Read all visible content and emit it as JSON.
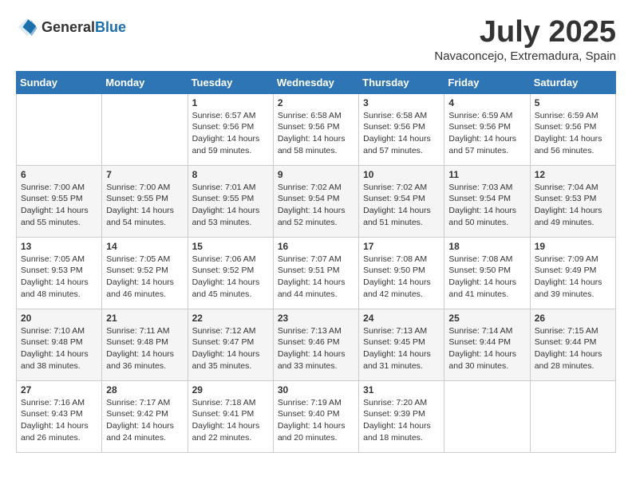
{
  "header": {
    "logo_general": "General",
    "logo_blue": "Blue",
    "month": "July 2025",
    "location": "Navaconcejo, Extremadura, Spain"
  },
  "weekdays": [
    "Sunday",
    "Monday",
    "Tuesday",
    "Wednesday",
    "Thursday",
    "Friday",
    "Saturday"
  ],
  "weeks": [
    [
      {
        "day": "",
        "sunrise": "",
        "sunset": "",
        "daylight": ""
      },
      {
        "day": "",
        "sunrise": "",
        "sunset": "",
        "daylight": ""
      },
      {
        "day": "1",
        "sunrise": "Sunrise: 6:57 AM",
        "sunset": "Sunset: 9:56 PM",
        "daylight": "Daylight: 14 hours and 59 minutes."
      },
      {
        "day": "2",
        "sunrise": "Sunrise: 6:58 AM",
        "sunset": "Sunset: 9:56 PM",
        "daylight": "Daylight: 14 hours and 58 minutes."
      },
      {
        "day": "3",
        "sunrise": "Sunrise: 6:58 AM",
        "sunset": "Sunset: 9:56 PM",
        "daylight": "Daylight: 14 hours and 57 minutes."
      },
      {
        "day": "4",
        "sunrise": "Sunrise: 6:59 AM",
        "sunset": "Sunset: 9:56 PM",
        "daylight": "Daylight: 14 hours and 57 minutes."
      },
      {
        "day": "5",
        "sunrise": "Sunrise: 6:59 AM",
        "sunset": "Sunset: 9:56 PM",
        "daylight": "Daylight: 14 hours and 56 minutes."
      }
    ],
    [
      {
        "day": "6",
        "sunrise": "Sunrise: 7:00 AM",
        "sunset": "Sunset: 9:55 PM",
        "daylight": "Daylight: 14 hours and 55 minutes."
      },
      {
        "day": "7",
        "sunrise": "Sunrise: 7:00 AM",
        "sunset": "Sunset: 9:55 PM",
        "daylight": "Daylight: 14 hours and 54 minutes."
      },
      {
        "day": "8",
        "sunrise": "Sunrise: 7:01 AM",
        "sunset": "Sunset: 9:55 PM",
        "daylight": "Daylight: 14 hours and 53 minutes."
      },
      {
        "day": "9",
        "sunrise": "Sunrise: 7:02 AM",
        "sunset": "Sunset: 9:54 PM",
        "daylight": "Daylight: 14 hours and 52 minutes."
      },
      {
        "day": "10",
        "sunrise": "Sunrise: 7:02 AM",
        "sunset": "Sunset: 9:54 PM",
        "daylight": "Daylight: 14 hours and 51 minutes."
      },
      {
        "day": "11",
        "sunrise": "Sunrise: 7:03 AM",
        "sunset": "Sunset: 9:54 PM",
        "daylight": "Daylight: 14 hours and 50 minutes."
      },
      {
        "day": "12",
        "sunrise": "Sunrise: 7:04 AM",
        "sunset": "Sunset: 9:53 PM",
        "daylight": "Daylight: 14 hours and 49 minutes."
      }
    ],
    [
      {
        "day": "13",
        "sunrise": "Sunrise: 7:05 AM",
        "sunset": "Sunset: 9:53 PM",
        "daylight": "Daylight: 14 hours and 48 minutes."
      },
      {
        "day": "14",
        "sunrise": "Sunrise: 7:05 AM",
        "sunset": "Sunset: 9:52 PM",
        "daylight": "Daylight: 14 hours and 46 minutes."
      },
      {
        "day": "15",
        "sunrise": "Sunrise: 7:06 AM",
        "sunset": "Sunset: 9:52 PM",
        "daylight": "Daylight: 14 hours and 45 minutes."
      },
      {
        "day": "16",
        "sunrise": "Sunrise: 7:07 AM",
        "sunset": "Sunset: 9:51 PM",
        "daylight": "Daylight: 14 hours and 44 minutes."
      },
      {
        "day": "17",
        "sunrise": "Sunrise: 7:08 AM",
        "sunset": "Sunset: 9:50 PM",
        "daylight": "Daylight: 14 hours and 42 minutes."
      },
      {
        "day": "18",
        "sunrise": "Sunrise: 7:08 AM",
        "sunset": "Sunset: 9:50 PM",
        "daylight": "Daylight: 14 hours and 41 minutes."
      },
      {
        "day": "19",
        "sunrise": "Sunrise: 7:09 AM",
        "sunset": "Sunset: 9:49 PM",
        "daylight": "Daylight: 14 hours and 39 minutes."
      }
    ],
    [
      {
        "day": "20",
        "sunrise": "Sunrise: 7:10 AM",
        "sunset": "Sunset: 9:48 PM",
        "daylight": "Daylight: 14 hours and 38 minutes."
      },
      {
        "day": "21",
        "sunrise": "Sunrise: 7:11 AM",
        "sunset": "Sunset: 9:48 PM",
        "daylight": "Daylight: 14 hours and 36 minutes."
      },
      {
        "day": "22",
        "sunrise": "Sunrise: 7:12 AM",
        "sunset": "Sunset: 9:47 PM",
        "daylight": "Daylight: 14 hours and 35 minutes."
      },
      {
        "day": "23",
        "sunrise": "Sunrise: 7:13 AM",
        "sunset": "Sunset: 9:46 PM",
        "daylight": "Daylight: 14 hours and 33 minutes."
      },
      {
        "day": "24",
        "sunrise": "Sunrise: 7:13 AM",
        "sunset": "Sunset: 9:45 PM",
        "daylight": "Daylight: 14 hours and 31 minutes."
      },
      {
        "day": "25",
        "sunrise": "Sunrise: 7:14 AM",
        "sunset": "Sunset: 9:44 PM",
        "daylight": "Daylight: 14 hours and 30 minutes."
      },
      {
        "day": "26",
        "sunrise": "Sunrise: 7:15 AM",
        "sunset": "Sunset: 9:44 PM",
        "daylight": "Daylight: 14 hours and 28 minutes."
      }
    ],
    [
      {
        "day": "27",
        "sunrise": "Sunrise: 7:16 AM",
        "sunset": "Sunset: 9:43 PM",
        "daylight": "Daylight: 14 hours and 26 minutes."
      },
      {
        "day": "28",
        "sunrise": "Sunrise: 7:17 AM",
        "sunset": "Sunset: 9:42 PM",
        "daylight": "Daylight: 14 hours and 24 minutes."
      },
      {
        "day": "29",
        "sunrise": "Sunrise: 7:18 AM",
        "sunset": "Sunset: 9:41 PM",
        "daylight": "Daylight: 14 hours and 22 minutes."
      },
      {
        "day": "30",
        "sunrise": "Sunrise: 7:19 AM",
        "sunset": "Sunset: 9:40 PM",
        "daylight": "Daylight: 14 hours and 20 minutes."
      },
      {
        "day": "31",
        "sunrise": "Sunrise: 7:20 AM",
        "sunset": "Sunset: 9:39 PM",
        "daylight": "Daylight: 14 hours and 18 minutes."
      },
      {
        "day": "",
        "sunrise": "",
        "sunset": "",
        "daylight": ""
      },
      {
        "day": "",
        "sunrise": "",
        "sunset": "",
        "daylight": ""
      }
    ]
  ]
}
